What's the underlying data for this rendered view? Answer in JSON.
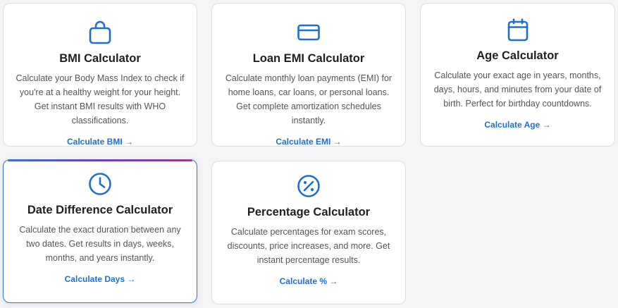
{
  "cards": [
    {
      "icon": "briefcase-icon",
      "title": "BMI Calculator",
      "description": "Calculate your Body Mass Index to check if you're at a healthy weight for your height. Get instant BMI results with WHO classifications.",
      "link": "Calculate BMI →"
    },
    {
      "icon": "credit-card-icon",
      "title": "Loan EMI Calculator",
      "description": "Calculate monthly loan payments (EMI) for home loans, car loans, or personal loans. Get complete amortization schedules instantly.",
      "link": "Calculate EMI →"
    },
    {
      "icon": "calendar-icon",
      "title": "Age Calculator",
      "description": "Calculate your exact age in years, months, days, hours, and minutes from your date of birth. Perfect for birthday countdowns.",
      "link": "Calculate Age →"
    },
    {
      "icon": "clock-icon",
      "title": "Date Difference Calculator",
      "description": "Calculate the exact duration between any two dates. Get results in days, weeks, months, and years instantly.",
      "link": "Calculate Days →"
    },
    {
      "icon": "percent-icon",
      "title": "Percentage Calculator",
      "description": "Calculate percentages for exam scores, discounts, price increases, and more. Get instant percentage results.",
      "link": "Calculate % →"
    }
  ],
  "colors": {
    "accent": "#1d6fd0",
    "active_border": "#2f78c9",
    "background": "#f5f5f7"
  }
}
